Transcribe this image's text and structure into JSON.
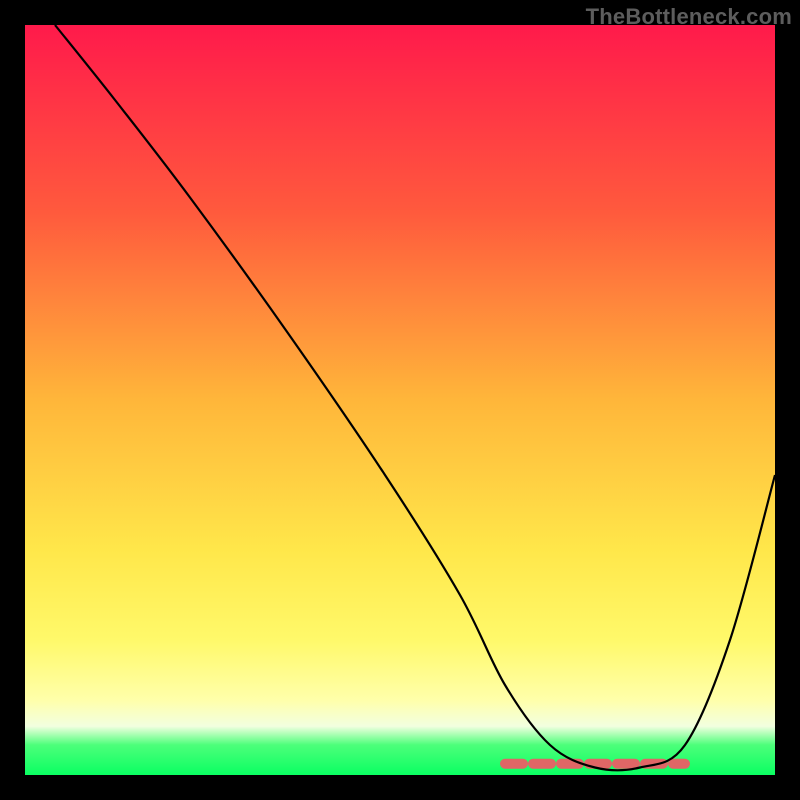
{
  "watermark": "TheBottleneck.com",
  "chart_data": {
    "type": "line",
    "title": "",
    "xlabel": "",
    "ylabel": "",
    "xlim": [
      0,
      100
    ],
    "ylim": [
      0,
      100
    ],
    "grid": false,
    "series": [
      {
        "name": "bottleneck-curve",
        "x": [
          4,
          12,
          22,
          35,
          48,
          58,
          64,
          70,
          76,
          82,
          88,
          94,
          100
        ],
        "y": [
          100,
          90,
          77,
          59,
          40,
          24,
          12,
          4,
          1,
          1,
          4,
          18,
          40
        ]
      }
    ],
    "highlight": {
      "name": "optimal-range",
      "x_start": 64,
      "x_end": 88,
      "y": 1.5
    },
    "gradient_stops": [
      {
        "pos": 0,
        "color": "#ff1a4b"
      },
      {
        "pos": 0.25,
        "color": "#ff5a3d"
      },
      {
        "pos": 0.5,
        "color": "#ffb63a"
      },
      {
        "pos": 0.7,
        "color": "#ffe74a"
      },
      {
        "pos": 0.82,
        "color": "#fff96a"
      },
      {
        "pos": 0.9,
        "color": "#ffffaa"
      },
      {
        "pos": 0.935,
        "color": "#f2ffe0"
      },
      {
        "pos": 0.96,
        "color": "#4cff7a"
      },
      {
        "pos": 1.0,
        "color": "#0aff62"
      }
    ]
  }
}
